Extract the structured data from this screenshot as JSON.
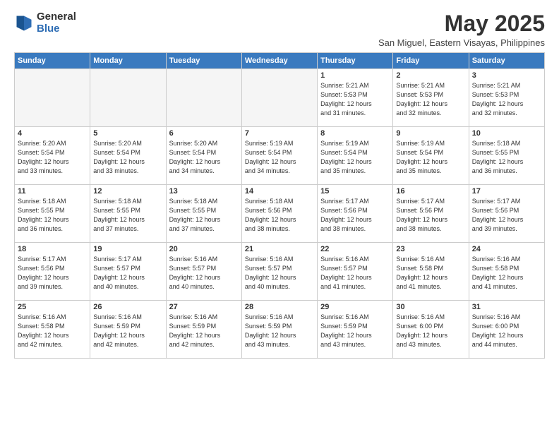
{
  "header": {
    "logo_line1": "General",
    "logo_line2": "Blue",
    "title": "May 2025",
    "subtitle": "San Miguel, Eastern Visayas, Philippines"
  },
  "weekdays": [
    "Sunday",
    "Monday",
    "Tuesday",
    "Wednesday",
    "Thursday",
    "Friday",
    "Saturday"
  ],
  "weeks": [
    [
      {
        "day": "",
        "info": ""
      },
      {
        "day": "",
        "info": ""
      },
      {
        "day": "",
        "info": ""
      },
      {
        "day": "",
        "info": ""
      },
      {
        "day": "1",
        "info": "Sunrise: 5:21 AM\nSunset: 5:53 PM\nDaylight: 12 hours\nand 31 minutes."
      },
      {
        "day": "2",
        "info": "Sunrise: 5:21 AM\nSunset: 5:53 PM\nDaylight: 12 hours\nand 32 minutes."
      },
      {
        "day": "3",
        "info": "Sunrise: 5:21 AM\nSunset: 5:53 PM\nDaylight: 12 hours\nand 32 minutes."
      }
    ],
    [
      {
        "day": "4",
        "info": "Sunrise: 5:20 AM\nSunset: 5:54 PM\nDaylight: 12 hours\nand 33 minutes."
      },
      {
        "day": "5",
        "info": "Sunrise: 5:20 AM\nSunset: 5:54 PM\nDaylight: 12 hours\nand 33 minutes."
      },
      {
        "day": "6",
        "info": "Sunrise: 5:20 AM\nSunset: 5:54 PM\nDaylight: 12 hours\nand 34 minutes."
      },
      {
        "day": "7",
        "info": "Sunrise: 5:19 AM\nSunset: 5:54 PM\nDaylight: 12 hours\nand 34 minutes."
      },
      {
        "day": "8",
        "info": "Sunrise: 5:19 AM\nSunset: 5:54 PM\nDaylight: 12 hours\nand 35 minutes."
      },
      {
        "day": "9",
        "info": "Sunrise: 5:19 AM\nSunset: 5:54 PM\nDaylight: 12 hours\nand 35 minutes."
      },
      {
        "day": "10",
        "info": "Sunrise: 5:18 AM\nSunset: 5:55 PM\nDaylight: 12 hours\nand 36 minutes."
      }
    ],
    [
      {
        "day": "11",
        "info": "Sunrise: 5:18 AM\nSunset: 5:55 PM\nDaylight: 12 hours\nand 36 minutes."
      },
      {
        "day": "12",
        "info": "Sunrise: 5:18 AM\nSunset: 5:55 PM\nDaylight: 12 hours\nand 37 minutes."
      },
      {
        "day": "13",
        "info": "Sunrise: 5:18 AM\nSunset: 5:55 PM\nDaylight: 12 hours\nand 37 minutes."
      },
      {
        "day": "14",
        "info": "Sunrise: 5:18 AM\nSunset: 5:56 PM\nDaylight: 12 hours\nand 38 minutes."
      },
      {
        "day": "15",
        "info": "Sunrise: 5:17 AM\nSunset: 5:56 PM\nDaylight: 12 hours\nand 38 minutes."
      },
      {
        "day": "16",
        "info": "Sunrise: 5:17 AM\nSunset: 5:56 PM\nDaylight: 12 hours\nand 38 minutes."
      },
      {
        "day": "17",
        "info": "Sunrise: 5:17 AM\nSunset: 5:56 PM\nDaylight: 12 hours\nand 39 minutes."
      }
    ],
    [
      {
        "day": "18",
        "info": "Sunrise: 5:17 AM\nSunset: 5:56 PM\nDaylight: 12 hours\nand 39 minutes."
      },
      {
        "day": "19",
        "info": "Sunrise: 5:17 AM\nSunset: 5:57 PM\nDaylight: 12 hours\nand 40 minutes."
      },
      {
        "day": "20",
        "info": "Sunrise: 5:16 AM\nSunset: 5:57 PM\nDaylight: 12 hours\nand 40 minutes."
      },
      {
        "day": "21",
        "info": "Sunrise: 5:16 AM\nSunset: 5:57 PM\nDaylight: 12 hours\nand 40 minutes."
      },
      {
        "day": "22",
        "info": "Sunrise: 5:16 AM\nSunset: 5:57 PM\nDaylight: 12 hours\nand 41 minutes."
      },
      {
        "day": "23",
        "info": "Sunrise: 5:16 AM\nSunset: 5:58 PM\nDaylight: 12 hours\nand 41 minutes."
      },
      {
        "day": "24",
        "info": "Sunrise: 5:16 AM\nSunset: 5:58 PM\nDaylight: 12 hours\nand 41 minutes."
      }
    ],
    [
      {
        "day": "25",
        "info": "Sunrise: 5:16 AM\nSunset: 5:58 PM\nDaylight: 12 hours\nand 42 minutes."
      },
      {
        "day": "26",
        "info": "Sunrise: 5:16 AM\nSunset: 5:59 PM\nDaylight: 12 hours\nand 42 minutes."
      },
      {
        "day": "27",
        "info": "Sunrise: 5:16 AM\nSunset: 5:59 PM\nDaylight: 12 hours\nand 42 minutes."
      },
      {
        "day": "28",
        "info": "Sunrise: 5:16 AM\nSunset: 5:59 PM\nDaylight: 12 hours\nand 43 minutes."
      },
      {
        "day": "29",
        "info": "Sunrise: 5:16 AM\nSunset: 5:59 PM\nDaylight: 12 hours\nand 43 minutes."
      },
      {
        "day": "30",
        "info": "Sunrise: 5:16 AM\nSunset: 6:00 PM\nDaylight: 12 hours\nand 43 minutes."
      },
      {
        "day": "31",
        "info": "Sunrise: 5:16 AM\nSunset: 6:00 PM\nDaylight: 12 hours\nand 44 minutes."
      }
    ]
  ]
}
